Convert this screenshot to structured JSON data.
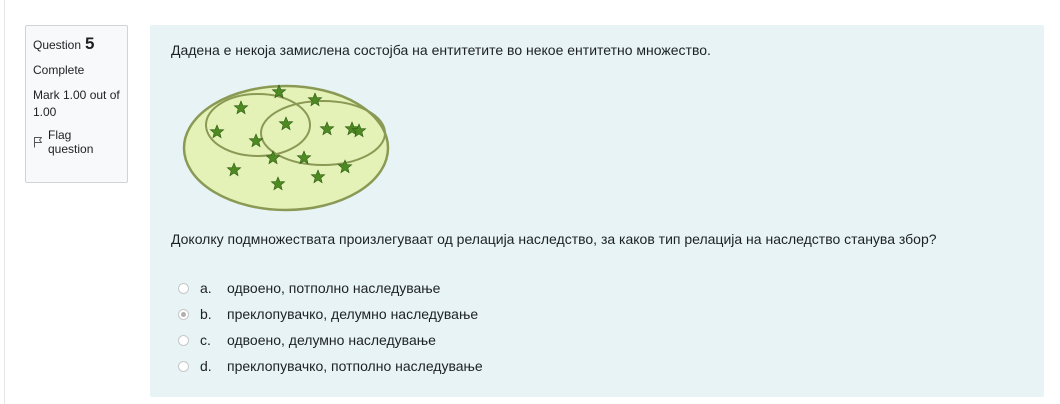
{
  "info": {
    "question_label": "Question",
    "question_number": "5",
    "state": "Complete",
    "grade": "Mark 1.00 out of 1.00",
    "flag_label": "Flag question"
  },
  "question": {
    "text": "Дадена е некоја замислена состојба на ентитетите во некое ентитетно множество.",
    "prompt": "Доколку подмножествата произлегуваат од релација наследство, за каков тип релација на наследство станува збор?"
  },
  "answers": [
    {
      "letter": "a.",
      "text": "одвоено, потполно наследување",
      "selected": false
    },
    {
      "letter": "b.",
      "text": "преклопувачко, делумно наследување",
      "selected": true
    },
    {
      "letter": "c.",
      "text": "одвоено, делумно наследување",
      "selected": false
    },
    {
      "letter": "d.",
      "text": "преклопувачко, потполно наследување",
      "selected": false
    }
  ],
  "colors": {
    "panel_bg": "#e7f3f5",
    "set_fill": "#e4f2b8",
    "set_stroke": "#8a9a55",
    "star_fill": "#4e8a22"
  }
}
